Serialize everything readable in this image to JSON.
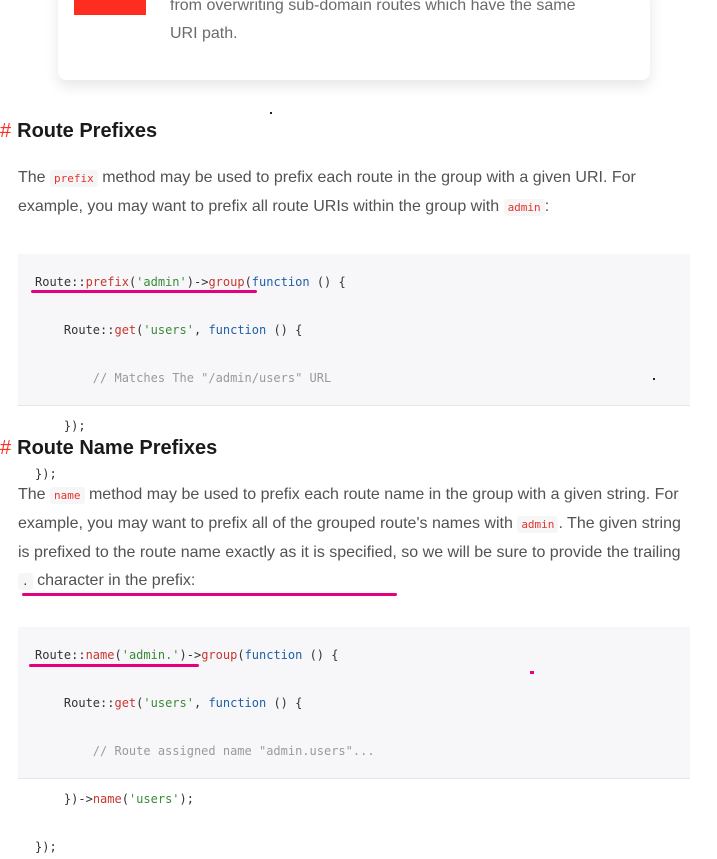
{
  "note": {
    "line1": "from overwriting sub-domain routes which have the same",
    "line2": "URI path."
  },
  "section1": {
    "heading": "Route Prefixes",
    "hash": "#",
    "para_before": "The ",
    "para_code": "prefix",
    "para_mid": " method may be used to prefix each route in the group with a given URI. For example, you may want to prefix all route URIs within the group with ",
    "para_code2": "admin",
    "para_end": ":",
    "code": {
      "l1_class": "Route",
      "l1_sep": "::",
      "l1_fn": "prefix",
      "l1_arg": "'admin'",
      "l1_arrow": ")->",
      "l1_fn2": "group",
      "l1_kw": "function",
      "l1_rest": " () {",
      "l2_class": "Route",
      "l2_fn": "get",
      "l2_arg": "'users'",
      "l2_kw": "function",
      "l2_rest": " () {",
      "l3_comment": "// Matches The \"/admin/users\" URL",
      "l4": "});",
      "l5": "});"
    }
  },
  "section2": {
    "heading": "Route Name Prefixes",
    "hash": "#",
    "para_before": "The ",
    "para_code": "name",
    "para_mid": " method may be used to prefix each route name in the group with a given string. For example, you may want to prefix all of the grouped route's names with ",
    "para_code2": "admin",
    "para_mid2": ". The given string is prefixed to the route name exactly as it is specified, so we will be sure to provide the trailing ",
    "para_code3": ".",
    "para_end": " character in the prefix:",
    "code": {
      "l1_class": "Route",
      "l1_sep": "::",
      "l1_fn": "name",
      "l1_arg": "'admin.'",
      "l1_arrow": ")->",
      "l1_fn2": "group",
      "l1_kw": "function",
      "l1_rest": " () {",
      "l2_class": "Route",
      "l2_fn": "get",
      "l2_arg": "'users'",
      "l2_kw": "function",
      "l2_rest": " () {",
      "l3_comment": "// Route assigned name \"admin.users\"...",
      "l4_pre": "})->",
      "l4_fn": "name",
      "l4_arg": "'users'",
      "l4_end": ");",
      "l5": "});"
    }
  },
  "colors": {
    "accent": "#ff2d20",
    "highlight": "#e5007e"
  }
}
